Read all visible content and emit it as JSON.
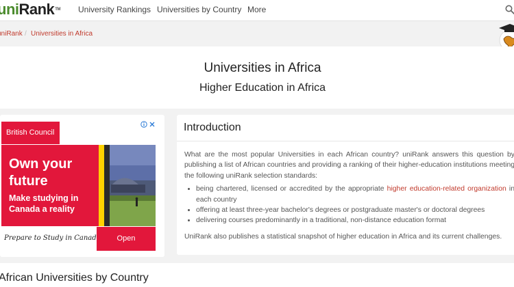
{
  "header": {
    "logo_prefix": "uni",
    "logo_main": "Rank",
    "logo_tm": "TM",
    "nav": [
      "University Rankings",
      "Universities by Country",
      "More"
    ]
  },
  "breadcrumb": [
    "uniRank",
    "Universities in Africa"
  ],
  "hero": {
    "title": "Universities in Africa",
    "subtitle": "Higher Education in Africa"
  },
  "ad": {
    "advertiser": "British Council",
    "headline": "Own your future",
    "subhead": "Make studying in Canada a reality",
    "tagline": "Prepare to Study in Canada",
    "cta": "Open",
    "choices_icon": "info-icon",
    "close_icon": "close-icon",
    "brand_color": "#e2173b"
  },
  "intro": {
    "title": "Introduction",
    "paragraph": "What are the most popular Universities in each African country? uniRank answers this question by publishing a list of African countries and providing a ranking of their higher-education institutions meeting the following uniRank selection standards:",
    "bullet1_pre": "being chartered, licensed or accredited by the appropriate ",
    "bullet1_link": "higher education-related organization",
    "bullet1_post": " in each country",
    "bullet2": "offering at least three-year bachelor's degrees or postgraduate master's or doctoral degrees",
    "bullet3": "delivering courses predominantly in a traditional, non-distance education format",
    "tail": "UniRank also publishes a statistical snapshot of higher education in Africa and its current challenges."
  },
  "section": {
    "title": "African Universities by Country"
  },
  "colors": {
    "accent": "#c0392b",
    "logo_green": "#4a8b2c"
  }
}
